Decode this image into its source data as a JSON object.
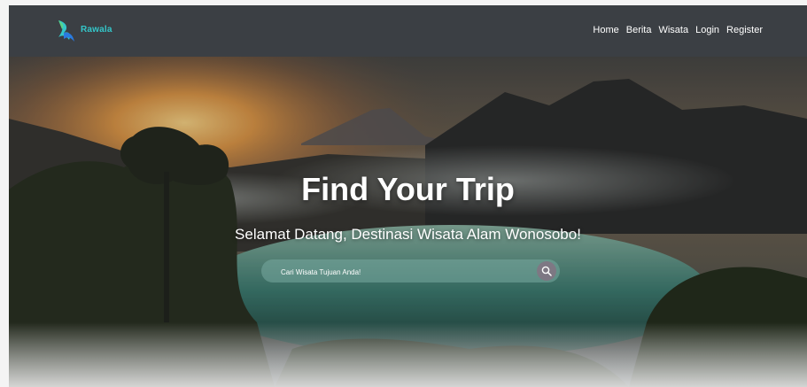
{
  "brand": {
    "name": "Rawala",
    "logo_icon": "bird-logo-icon",
    "accent_color": "#34c6c9"
  },
  "nav": {
    "items": [
      "Home",
      "Berita",
      "Wisata",
      "Login",
      "Register"
    ]
  },
  "hero": {
    "title": "Find Your Trip",
    "subtitle": "Selamat Datang, Destinasi Wisata Alam Wonosobo!",
    "background": "lake-mountain-sunrise-image"
  },
  "search": {
    "placeholder": "Cari Wisata Tujuan Anda!",
    "icon": "search-icon"
  }
}
